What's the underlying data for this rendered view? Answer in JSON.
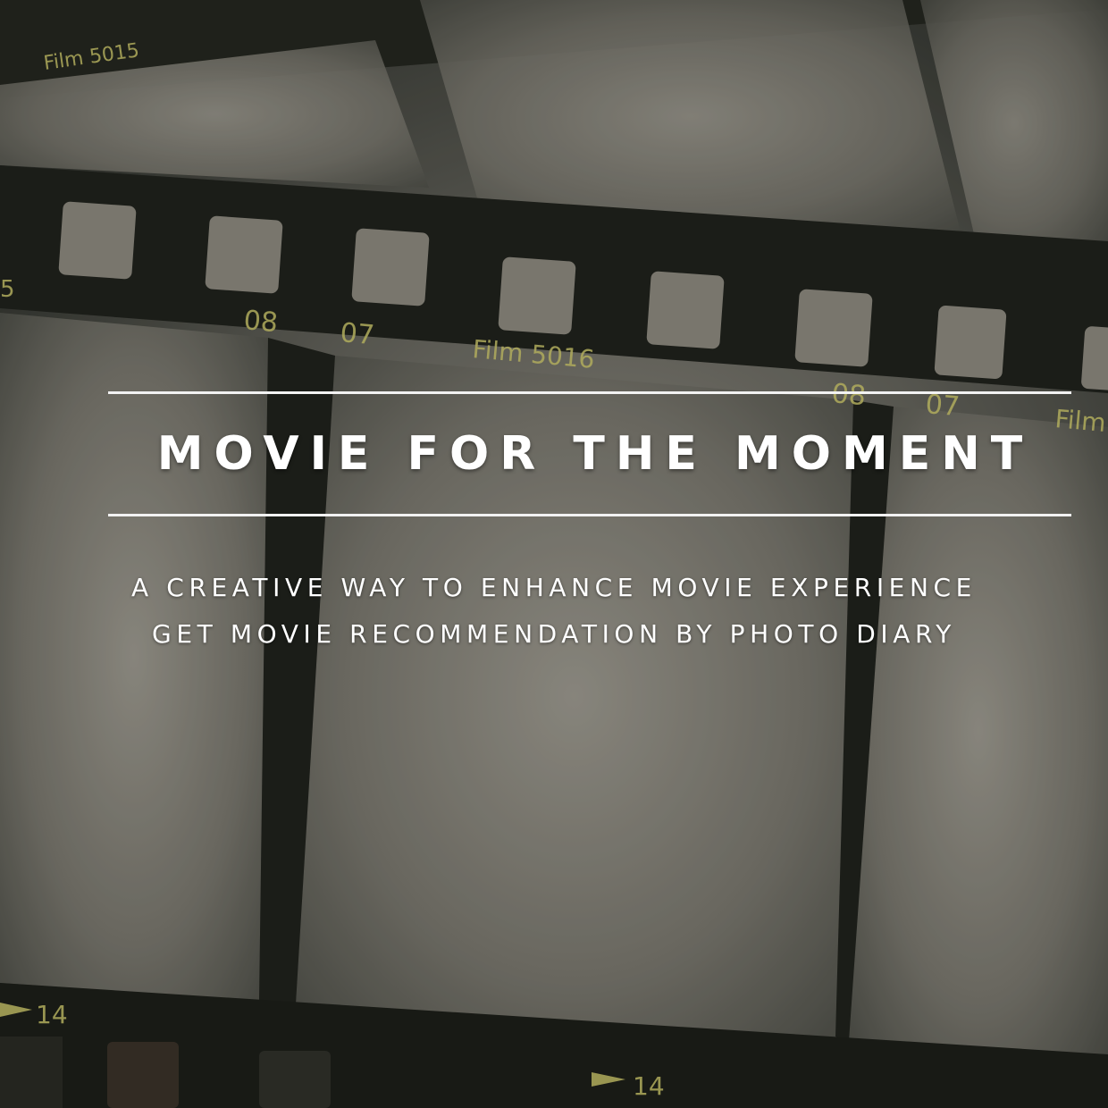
{
  "hero": {
    "title": "MOVIE FOR THE MOMENT",
    "subtitle_lines": [
      "A CREATIVE WAY TO ENHANCE MOVIE EXPERIENCE",
      "GET MOVIE RECOMMENDATION BY PHOTO DIARY"
    ]
  },
  "background": {
    "film_labels": [
      "Film 5015",
      "08",
      "07",
      "Film 5016",
      "08",
      "07",
      "Film",
      "14",
      "14",
      "5"
    ],
    "accent_color": "#c9c46a"
  }
}
